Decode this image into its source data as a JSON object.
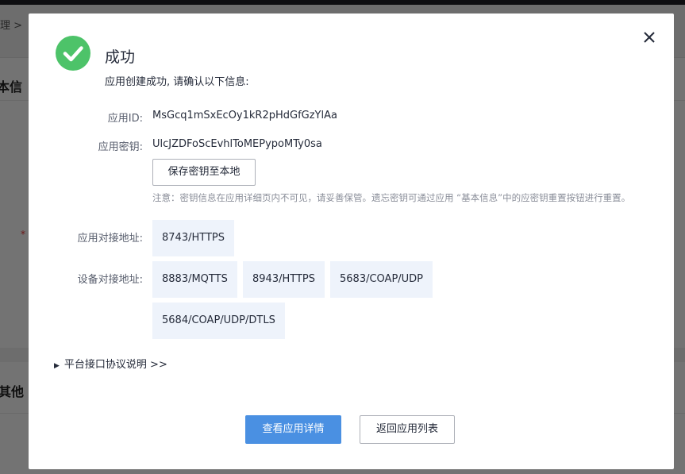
{
  "background": {
    "breadcrumb": "理 > ",
    "card_title": "本信",
    "required_mark": "*",
    "card2_title": "其他"
  },
  "modal": {
    "title": "成功",
    "subtitle": "应用创建成功, 请确认以下信息:",
    "app_id_label": "应用ID:",
    "app_id_value": "MsGcq1mSxEcOy1kR2pHdGfGzYlAa",
    "app_secret_label": "应用密钥:",
    "app_secret_value": "UlcJZDFoScEvhlToMEPypoMTy0sa",
    "save_secret_label": "保存密钥至本地",
    "notice": "注意：密钥信息在应用详细页内不可见，请妥善保管。遗忘密钥可通过应用 “基本信息”中的应密钥重置按钮进行重置。",
    "app_address_label": "应用对接地址:",
    "app_addresses": [
      "8743/HTTPS"
    ],
    "device_address_label": "设备对接地址:",
    "device_addresses": [
      "8883/MQTTS",
      "8943/HTTPS",
      "5683/COAP/UDP",
      "5684/COAP/UDP/DTLS"
    ],
    "protocol_link": "平台接口协议说明 >>",
    "view_details_label": "查看应用详情",
    "back_to_list_label": "返回应用列表"
  },
  "colors": {
    "success": "#4dc369",
    "primary": "#4a90e2",
    "tag_bg": "#eef3fb"
  }
}
